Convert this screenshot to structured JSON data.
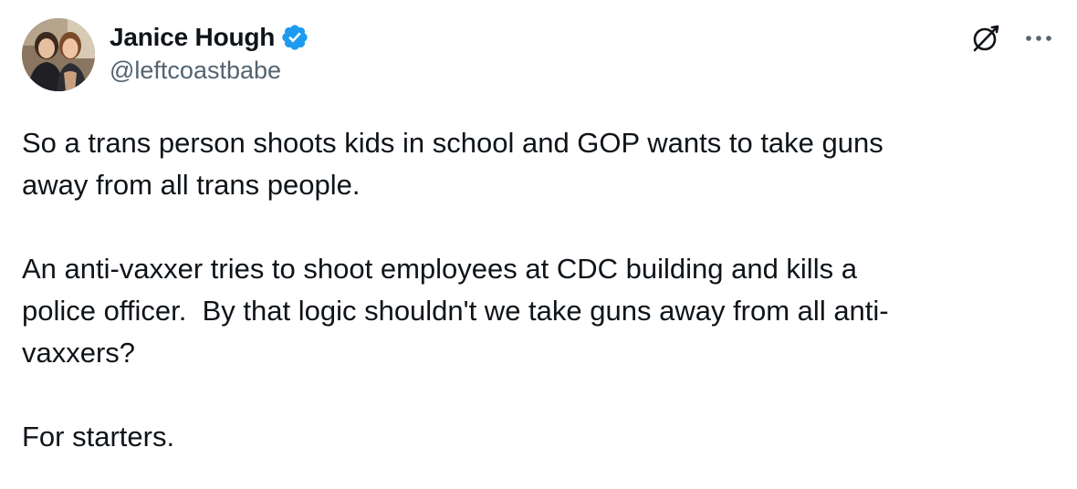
{
  "author": {
    "display_name": "Janice Hough",
    "handle": "@leftcoastbabe",
    "verified": true,
    "verified_color": "#1d9bf0"
  },
  "header_icons": {
    "grok": "grok-icon",
    "more": "more-options-icon"
  },
  "tweet": {
    "paragraphs": [
      "So a trans person shoots kids in school and GOP wants to take guns\naway from all trans people.",
      "An anti-vaxxer tries to shoot employees at CDC building and kills a\npolice officer.  By that logic shouldn't we take guns away from all anti-\nvaxxers?",
      "For starters."
    ]
  },
  "colors": {
    "text_primary": "#0f1419",
    "text_secondary": "#536471",
    "background": "#ffffff"
  }
}
